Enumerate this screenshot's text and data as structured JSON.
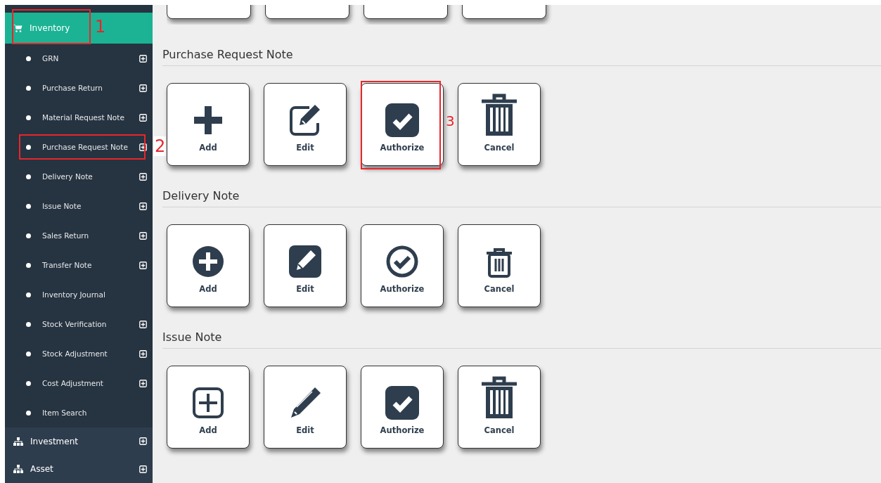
{
  "sidebar": {
    "header": {
      "label": "Inventory",
      "selected": true,
      "annotation": "1"
    },
    "items": [
      {
        "label": "GRN",
        "expandable": true
      },
      {
        "label": "Purchase Return",
        "expandable": true
      },
      {
        "label": "Material Request Note",
        "expandable": true
      },
      {
        "label": "Purchase Request Note",
        "expandable": true,
        "annotation": "2"
      },
      {
        "label": "Delivery Note",
        "expandable": true
      },
      {
        "label": "Issue Note",
        "expandable": true
      },
      {
        "label": "Sales Return",
        "expandable": true
      },
      {
        "label": "Transfer Note",
        "expandable": true
      },
      {
        "label": "Inventory Journal",
        "expandable": false
      },
      {
        "label": "Stock Verification",
        "expandable": true
      },
      {
        "label": "Stock Adjustment",
        "expandable": true
      },
      {
        "label": "Cost Adjustment",
        "expandable": true
      },
      {
        "label": "Item Search",
        "expandable": false
      }
    ],
    "groups": [
      {
        "label": "Investment",
        "expandable": true
      },
      {
        "label": "Asset",
        "expandable": true
      }
    ]
  },
  "sections": [
    {
      "title": "Purchase Request Note",
      "buttons": [
        {
          "label": "Add",
          "kind": "add"
        },
        {
          "label": "Edit",
          "kind": "edit"
        },
        {
          "label": "Authorize",
          "kind": "authorize",
          "annotation": "3"
        },
        {
          "label": "Cancel",
          "kind": "cancel"
        }
      ]
    },
    {
      "title": "Delivery Note",
      "buttons": [
        {
          "label": "Add",
          "kind": "add"
        },
        {
          "label": "Edit",
          "kind": "edit"
        },
        {
          "label": "Authorize",
          "kind": "authorize"
        },
        {
          "label": "Cancel",
          "kind": "cancel"
        }
      ]
    },
    {
      "title": "Issue Note",
      "buttons": [
        {
          "label": "Add",
          "kind": "add"
        },
        {
          "label": "Edit",
          "kind": "edit"
        },
        {
          "label": "Authorize",
          "kind": "authorize"
        },
        {
          "label": "Cancel",
          "kind": "cancel"
        }
      ]
    }
  ]
}
